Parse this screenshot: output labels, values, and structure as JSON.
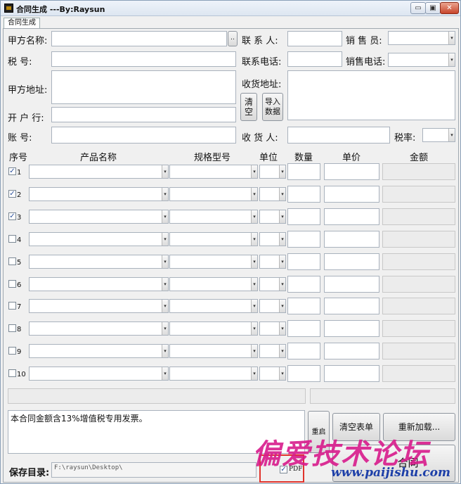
{
  "window": {
    "title": "合同生成 ---By:Raysun",
    "minimize": "▭",
    "restore": "▣",
    "close": "✕"
  },
  "tab": {
    "label": "合同生成"
  },
  "header": {
    "party_a_name_label": "甲方名称:",
    "party_a_name_btn": "..",
    "contact_label": "联 系 人:",
    "sales_label": "销 售 员:",
    "tax_no_label": "税    号:",
    "contact_phone_label": "联系电话:",
    "sales_phone_label": "销售电话:",
    "address_label": "甲方地址:",
    "ship_addr_label": "收货地址:",
    "clear_btn": "清空",
    "import_btn": "导入数据",
    "bank_label": "开 户 行:",
    "account_label": "账    号:",
    "receiver_label": "收 货 人:",
    "tax_rate_label": "税率:"
  },
  "table": {
    "columns": [
      "序号",
      "产品名称",
      "规格型号",
      "单位",
      "数量",
      "单价",
      "金额"
    ],
    "rows": [
      {
        "num": "1",
        "checked": "✓"
      },
      {
        "num": "2",
        "checked": "✓"
      },
      {
        "num": "3",
        "checked": "✓"
      },
      {
        "num": "4",
        "checked": ""
      },
      {
        "num": "5",
        "checked": ""
      },
      {
        "num": "6",
        "checked": ""
      },
      {
        "num": "7",
        "checked": ""
      },
      {
        "num": "8",
        "checked": ""
      },
      {
        "num": "9",
        "checked": ""
      },
      {
        "num": "10",
        "checked": ""
      }
    ]
  },
  "footer": {
    "notes": "本合同金额含13%增值税专用发票。",
    "restart_btn": "重启",
    "clear_form_btn": "清空表单",
    "reload_btn": "重新加载...",
    "generate_btn": "合同",
    "save_dir_label": "保存目录:",
    "save_dir_value": "F:\\raysun\\Desktop\\",
    "pdf_check": "✓",
    "pdf_label": "PDF"
  },
  "watermark": {
    "text": "偏爱技术论坛",
    "url": "www.paijishu.com"
  },
  "colors": {
    "accent": "#2a4f9c",
    "watermark_pink": "#d81b8c",
    "watermark_blue": "#1d3fa8"
  }
}
